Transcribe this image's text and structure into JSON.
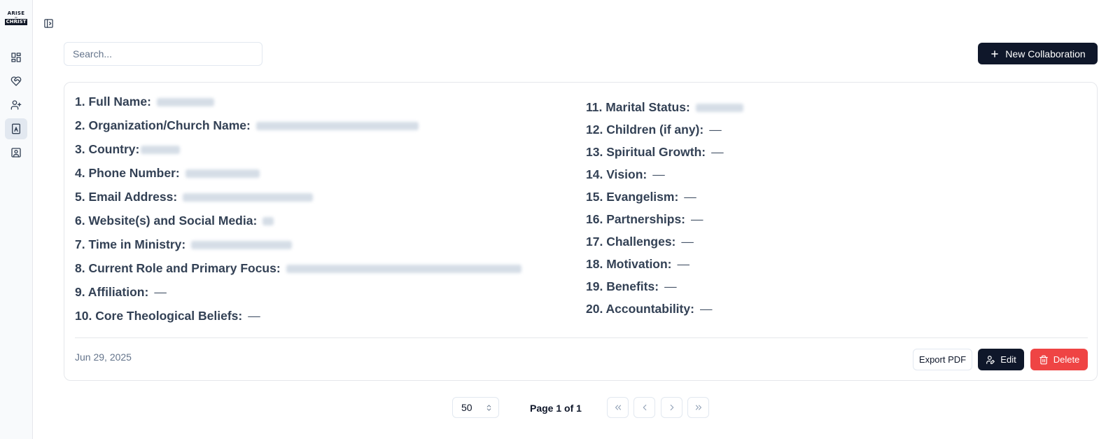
{
  "sidebar": {
    "logo_top": "ARISE",
    "logo_mid": "IN",
    "logo_bottom": "CHRIST",
    "items": [
      {
        "icon": "dashboard-icon"
      },
      {
        "icon": "heart-handshake-icon"
      },
      {
        "icon": "user-plus-icon"
      },
      {
        "icon": "document-icon",
        "active": true
      },
      {
        "icon": "contact-icon"
      }
    ]
  },
  "toolbar": {
    "search_placeholder": "Search...",
    "new_label": "New Collaboration"
  },
  "card": {
    "left_fields": [
      {
        "label": "1. Full Name:",
        "redacted": true
      },
      {
        "label": "2. Organization/Church Name:",
        "redacted": true
      },
      {
        "label": "3. Country:",
        "redacted": true
      },
      {
        "label": "4. Phone Number:",
        "redacted": true
      },
      {
        "label": "5. Email Address:",
        "redacted": true
      },
      {
        "label": "6. Website(s) and Social Media:",
        "redacted": true
      },
      {
        "label": "7. Time in Ministry:",
        "redacted": true
      },
      {
        "label": "8. Current Role and Primary Focus:",
        "redacted": true
      },
      {
        "label": "9. Affiliation:",
        "value": "—"
      },
      {
        "label": "10. Core Theological Beliefs:",
        "value": "—"
      }
    ],
    "right_fields": [
      {
        "label": "11. Marital Status:",
        "redacted": true
      },
      {
        "label": "12. Children (if any):",
        "value": "—"
      },
      {
        "label": "13. Spiritual Growth:",
        "value": "—"
      },
      {
        "label": "14. Vision:",
        "value": "—"
      },
      {
        "label": "15. Evangelism:",
        "value": "—"
      },
      {
        "label": "16. Partnerships:",
        "value": "—"
      },
      {
        "label": "17. Challenges:",
        "value": "—"
      },
      {
        "label": "18. Motivation:",
        "value": "—"
      },
      {
        "label": "19. Benefits:",
        "value": "—"
      },
      {
        "label": "20. Accountability:",
        "value": "—"
      }
    ],
    "date": "Jun 29, 2025",
    "export_label": "Export PDF",
    "edit_label": "Edit",
    "delete_label": "Delete",
    "colors": {
      "primary": "#0f172a",
      "danger": "#ef4444"
    }
  },
  "pagination": {
    "page_size": "50",
    "page_info": "Page 1 of 1"
  }
}
